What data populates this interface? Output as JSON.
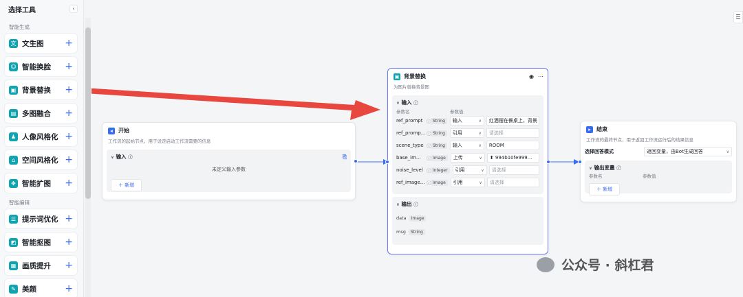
{
  "sidebar": {
    "title": "选择工具",
    "collapse_icon": "‹",
    "sections": [
      {
        "label": "智能生成"
      },
      {
        "label": "智能编辑"
      }
    ],
    "tools_gen": [
      {
        "label": "文生图",
        "icon": "文"
      },
      {
        "label": "智能换脸",
        "icon": "☺"
      },
      {
        "label": "背景替换",
        "icon": "▣"
      },
      {
        "label": "多图融合",
        "icon": "▤"
      },
      {
        "label": "人像风格化",
        "icon": "♟"
      },
      {
        "label": "空间风格化",
        "icon": "⌂"
      },
      {
        "label": "智能扩图",
        "icon": "✥"
      }
    ],
    "tools_edit": [
      {
        "label": "提示词优化",
        "icon": "☰"
      },
      {
        "label": "智能抠图",
        "icon": "◩"
      },
      {
        "label": "画质提升",
        "icon": "▦"
      },
      {
        "label": "美颜",
        "icon": "✎"
      }
    ],
    "plus": "+"
  },
  "start_node": {
    "title": "开始",
    "desc": "工作流的起始节点，用于设定启动工作流需要的信息",
    "input_label": "输入",
    "empty": "未定义输入参数",
    "add": "＋ 新增"
  },
  "bg_node": {
    "title": "背景替换",
    "desc": "为图片替换背景图",
    "input_label": "输入",
    "col_name": "参数名",
    "col_value": "参数值",
    "params": [
      {
        "name": "ref_prompt",
        "type": "String",
        "mode": "输入",
        "value": "红酒摆在餐桌上，背景",
        "ph": false
      },
      {
        "name": "ref_promp...",
        "type": "String",
        "mode": "引用",
        "value": "请选择",
        "ph": true
      },
      {
        "name": "scene_type",
        "type": "String",
        "mode": "输入",
        "value": "ROOM",
        "ph": false
      },
      {
        "name": "base_im...",
        "type": "Image",
        "mode": "上传",
        "value": "⬍ 994b10fe999...",
        "ph": false
      },
      {
        "name": "noise_level",
        "type": "Integer",
        "mode": "引用",
        "value": "请选择",
        "ph": true
      },
      {
        "name": "ref_image...",
        "type": "Image",
        "mode": "引用",
        "value": "请选择",
        "ph": true
      }
    ],
    "output_label": "输出",
    "outputs": [
      {
        "name": "data",
        "type": "Image"
      },
      {
        "name": "msg",
        "type": "String"
      }
    ]
  },
  "end_node": {
    "title": "结束",
    "desc": "工作流的最终节点，用于返回工作流运行后的结果信息",
    "mode_label": "选择回答模式",
    "mode_value": "返回变量，由Bot生成回答",
    "output_label": "输出变量",
    "col_name": "参数名",
    "col_value": "参数值",
    "add": "＋ 新增"
  },
  "watermark": "公众号 · 斜杠君",
  "colors": {
    "accent": "#3a6cf0",
    "arrow": "#e8473f",
    "teal": "#10a3b0"
  }
}
